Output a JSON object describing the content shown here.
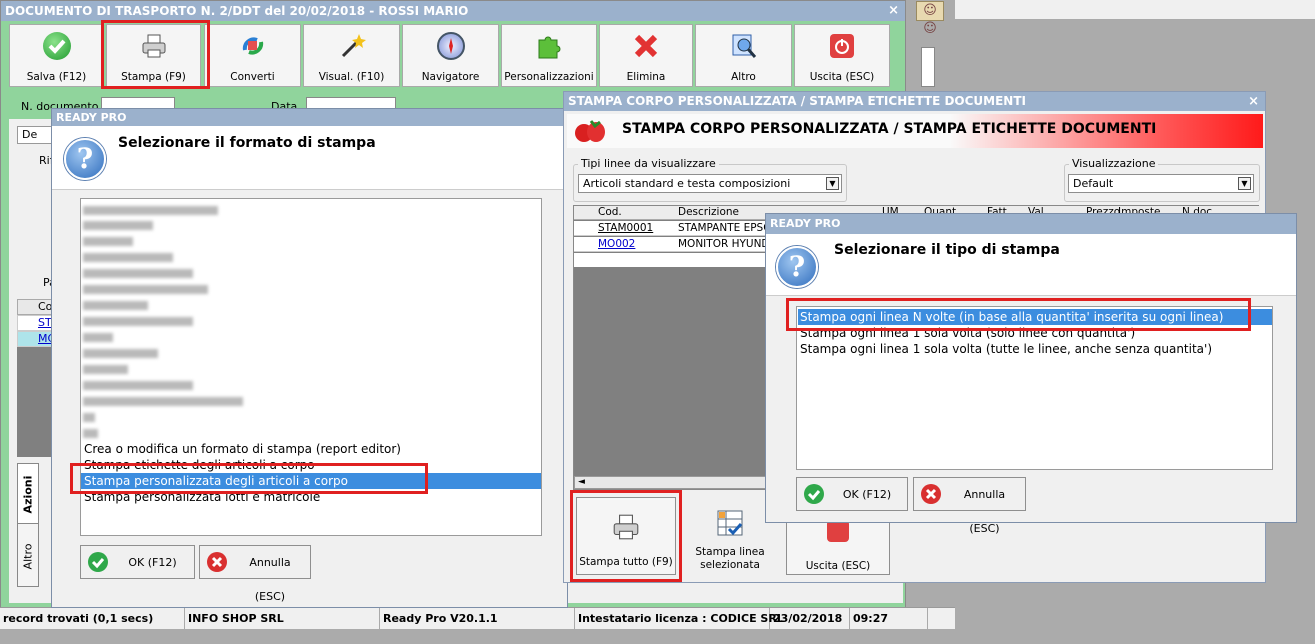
{
  "main": {
    "title": "DOCUMENTO DI TRASPORTO N. 2/DDT del 20/02/2018 - ROSSI MARIO",
    "close_icon": "×",
    "toolbar": [
      {
        "label": "Salva (F12)",
        "icon": "check-icon"
      },
      {
        "label": "Stampa (F9)",
        "icon": "printer-icon"
      },
      {
        "label": "Converti",
        "icon": "convert-icon"
      },
      {
        "label": "Visual. (F10)",
        "icon": "magic-wand-icon"
      },
      {
        "label": "Navigatore",
        "icon": "compass-icon"
      },
      {
        "label": "Personalizzazioni",
        "icon": "puzzle-icon"
      },
      {
        "label": "Elimina",
        "icon": "delete-icon"
      },
      {
        "label": "Altro",
        "icon": "magnifier-icon"
      },
      {
        "label": "Uscita (ESC)",
        "icon": "power-icon"
      }
    ],
    "doc_number_label": "N. documento",
    "date_label": "Data",
    "tab_partial": "De",
    "ri_partial": "Rif",
    "pa_partial": "Pa",
    "co_partial": "Co",
    "row1_partial": "ST",
    "row2_partial": "MC",
    "side_tab_azioni": "Azioni",
    "side_tab_altro": "Altro"
  },
  "status": {
    "records": "record trovati (0,1 secs)",
    "company": "INFO SHOP SRL",
    "version": "Ready Pro V20.1.1",
    "license": "Intestatario licenza : CODICE SRL",
    "date": "23/02/2018",
    "time": "09:27"
  },
  "dialog_format": {
    "title": "READY PRO",
    "heading": "Selezionare il formato di stampa",
    "items": [
      "Crea o modifica un formato di stampa (report editor)",
      "Stampa etichette degli articoli a corpo",
      "Stampa personalizzata degli articoli a corpo",
      "Stampa personalizzata lotti e matricole"
    ],
    "selected_index": 2,
    "ok_label": "OK (F12)",
    "cancel_label": "Annulla (ESC)"
  },
  "stampa_corpo": {
    "title": "STAMPA CORPO PERSONALIZZATA / STAMPA ETICHETTE DOCUMENTI",
    "banner": "STAMPA CORPO PERSONALIZZATA / STAMPA ETICHETTE DOCUMENTI",
    "close_icon": "×",
    "tipi_label": "Tipi linee da visualizzare",
    "tipi_value": "Articoli standard e testa composizioni",
    "vis_label": "Visualizzazione",
    "vis_value": "Default",
    "columns": [
      "Cod.",
      "Descrizione",
      "UM",
      "Quant.",
      "Fatt.",
      "Val.",
      "Prezzo",
      "Imposte",
      "N.doc."
    ],
    "rows": [
      {
        "cod": "STAM0001",
        "desc": "STAMPANTE EPSO"
      },
      {
        "cod": "MO002",
        "desc": "MONITOR HYUNDA"
      }
    ],
    "btn_stampa_tutto": "Stampa tutto (F9)",
    "btn_stampa_linea": "Stampa linea selezionata",
    "btn_uscita": "Uscita (ESC)"
  },
  "dialog_tipo": {
    "title": "READY PRO",
    "heading": "Selezionare il tipo di stampa",
    "items": [
      "Stampa ogni linea N volte (in base alla quantita' inserita su ogni linea)",
      "Stampa ogni linea 1 sola volta (solo linee con quantita')",
      "Stampa ogni linea 1 sola volta (tutte le linee, anche senza quantita')"
    ],
    "selected_index": 0,
    "ok_label": "OK (F12)",
    "cancel_label": "Annulla (ESC)"
  }
}
